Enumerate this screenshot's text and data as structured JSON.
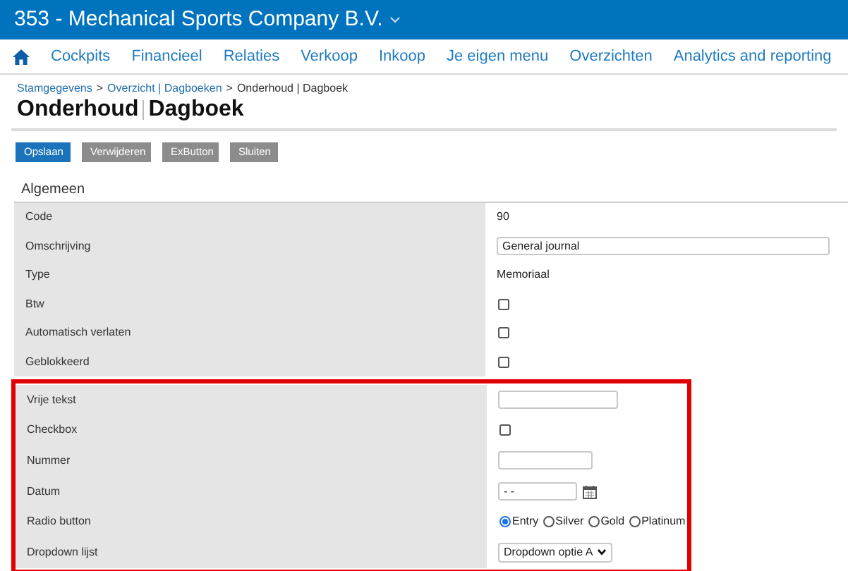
{
  "header": {
    "company": "353 - Mechanical Sports Company B.V."
  },
  "nav": {
    "items": [
      "Cockpits",
      "Financieel",
      "Relaties",
      "Verkoop",
      "Inkoop",
      "Je eigen menu",
      "Overzichten",
      "Analytics and reporting"
    ]
  },
  "breadcrumb": [
    {
      "label": "Stamgegevens",
      "link": true
    },
    {
      "label": ">",
      "link": false
    },
    {
      "label": "Overzicht | Dagboeken",
      "link": true
    },
    {
      "label": ">",
      "link": false
    },
    {
      "label": "Onderhoud | Dagboek",
      "link": false
    }
  ],
  "title": {
    "main": "Onderhoud",
    "sub": "Dagboek"
  },
  "buttons": [
    {
      "label": "Opslaan",
      "primary": true
    },
    {
      "label": "Verwijderen",
      "primary": false
    },
    {
      "label": "ExButton",
      "primary": false
    },
    {
      "label": "Sluiten",
      "primary": false
    }
  ],
  "section": {
    "title": "Algemeen"
  },
  "fields": [
    {
      "label": "Code",
      "kind": "text",
      "value": "90"
    },
    {
      "label": "Omschrijving",
      "kind": "wide_input",
      "value": "General journal"
    },
    {
      "label": "Type",
      "kind": "text",
      "value": "Memoriaal"
    },
    {
      "label": "Btw",
      "kind": "checkbox",
      "checked": false
    },
    {
      "label": "Automatisch verlaten",
      "kind": "checkbox",
      "checked": false
    },
    {
      "label": "Geblokkeerd",
      "kind": "checkbox",
      "checked": false
    }
  ],
  "highlighted_fields": [
    {
      "label": "Vrije tekst",
      "kind": "input"
    },
    {
      "label": "Checkbox",
      "kind": "checkbox",
      "checked": false
    },
    {
      "label": "Nummer",
      "kind": "short_input"
    },
    {
      "label": "Datum",
      "kind": "date",
      "value": "- -"
    },
    {
      "label": "Radio button",
      "kind": "radio",
      "options": [
        {
          "label": "Entry",
          "selected": true
        },
        {
          "label": "Silver",
          "selected": false
        },
        {
          "label": "Gold",
          "selected": false
        },
        {
          "label": "Platinum",
          "selected": false
        }
      ]
    },
    {
      "label": "Dropdown lijst",
      "kind": "select",
      "value": "Dropdown optie A"
    }
  ]
}
